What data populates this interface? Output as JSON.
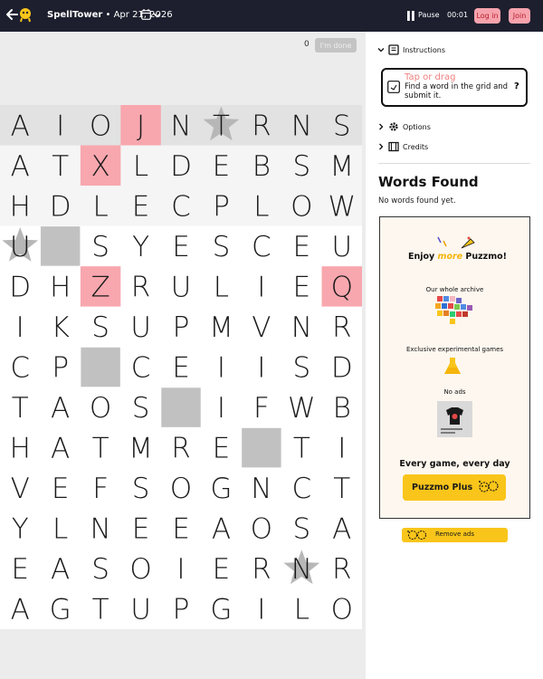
{
  "header": {
    "app_name": "SpellTower",
    "separator": " • ",
    "date": "Apr 21, 2026",
    "pause_label": "Pause",
    "timer": "00:01",
    "login_label": "Log in",
    "join_label": "Join"
  },
  "game": {
    "score": "0",
    "done_label": "I'm done",
    "grid": {
      "columns": 9,
      "rows": [
        "AIOJNTRNS",
        "ATXLDEBSM",
        "HDLECPLOW",
        "U SYESCEU",
        "DHZRULIEQ",
        "IKSUPMVNR",
        "CP CEIISD",
        "TAOS IFWB",
        "HATMRE TI",
        "VEFSOGNCT",
        "YLNEEAOSA",
        "EASOIERNR",
        "AGTUPGILO"
      ],
      "highlighted_rows": [
        0
      ],
      "pink_tiles": [
        [
          0,
          3
        ],
        [
          1,
          2
        ],
        [
          4,
          2
        ],
        [
          4,
          8
        ]
      ],
      "blocked_tiles": [
        [
          3,
          1
        ],
        [
          6,
          2
        ],
        [
          7,
          4
        ],
        [
          8,
          6
        ]
      ],
      "star_tiles": [
        [
          0,
          5
        ],
        [
          3,
          0
        ],
        [
          11,
          7
        ]
      ]
    }
  },
  "sidebar": {
    "instructions_label": "Instructions",
    "tip_title": "Tap or drag",
    "tip_text": "Find a word in the grid and submit it.",
    "tip_help": "?",
    "options_label": "Options",
    "credits_label": "Credits",
    "words_found_title": "Words Found",
    "words_found_empty": "No words found yet."
  },
  "ad": {
    "heading_pre": "Enjoy ",
    "heading_more": "more",
    "heading_post": " Puzzmo!",
    "feature_archive": "Our whole archive",
    "feature_games": "Exclusive experimental games",
    "feature_no_ads": "No ads",
    "tagline": "Every game, every day",
    "plus_label": "Puzzmo Plus",
    "remove_ads_label": "Remove ads"
  },
  "colors": {
    "header_bg": "#1d1f2e",
    "pink_tile": "#f8a7ae",
    "blocked_tile": "#c1c1c1",
    "highlight_row": "#e2e2e2",
    "accent_yellow": "#f9c51a"
  }
}
